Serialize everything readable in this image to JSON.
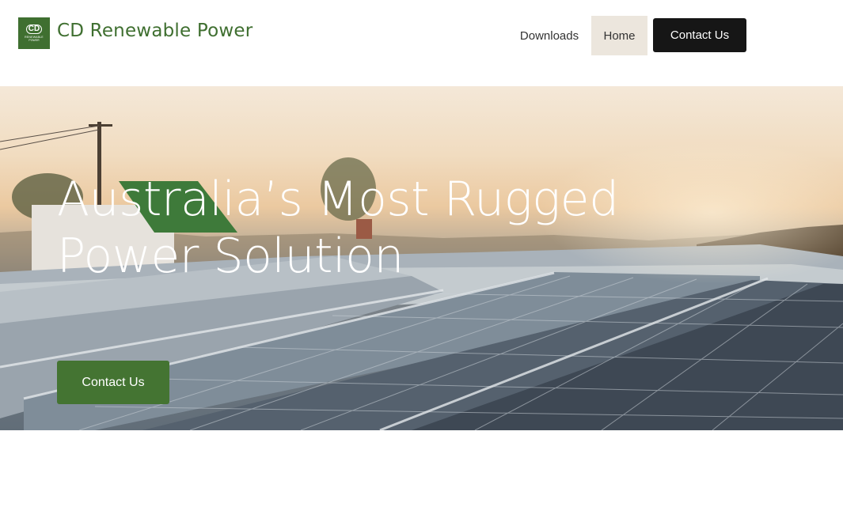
{
  "header": {
    "logo_text": "CD",
    "logo_sub1": "RENEWABLE",
    "logo_sub2": "POWER",
    "brand_name": "CD Renewable Power",
    "nav": {
      "downloads": "Downloads",
      "home": "Home",
      "contact": "Contact Us"
    }
  },
  "hero": {
    "title": "Australia’s Most Rugged Power Solution",
    "button": "Contact Us"
  },
  "colors": {
    "brand_green": "#3f6f30",
    "button_green": "#447432",
    "nav_active_bg": "#ece6dd",
    "nav_cta_bg": "#161616"
  }
}
